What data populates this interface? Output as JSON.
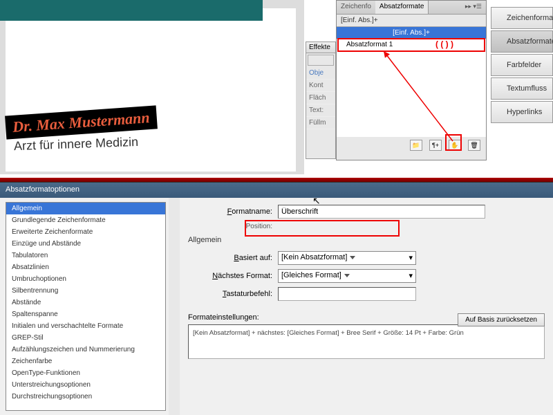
{
  "document": {
    "name": "Dr. Max Mustermann",
    "subtitle": "Arzt für innere Medizin"
  },
  "right_toolbar": {
    "items": [
      {
        "label": "Zeichenformate"
      },
      {
        "label": "Absatzformate"
      },
      {
        "label": "Farbfelder"
      },
      {
        "label": "Textumfluss"
      },
      {
        "label": "Hyperlinks"
      }
    ]
  },
  "effects": {
    "tab": "Effekte",
    "rows": [
      "Obje",
      "Kont",
      "Fläch",
      "Text:",
      "Füllm"
    ]
  },
  "styles_panel": {
    "tabs": [
      "Zeichenfo",
      "Absatzformate"
    ],
    "tab_icons": "▸▸ ▾☰",
    "subtitle": "[Einf. Abs.]+",
    "items": [
      {
        "label": "[Einf. Abs.]+",
        "selected": true
      },
      {
        "label": "Absatzformat 1",
        "selected": false
      }
    ],
    "annotation": "( (   ) )",
    "footer_icons": [
      "📁",
      "¶+",
      "✋",
      "🗑"
    ]
  },
  "dialog": {
    "title": "Absatzformatoptionen",
    "categories": [
      "Allgemein",
      "Grundlegende Zeichenformate",
      "Erweiterte Zeichenformate",
      "Einzüge und Abstände",
      "Tabulatoren",
      "Absatzlinien",
      "Umbruchoptionen",
      "Silbentrennung",
      "Abstände",
      "Spaltenspanne",
      "Initialen und verschachtelte Formate",
      "GREP-Stil",
      "Aufzählungszeichen und Nummerierung",
      "Zeichenfarbe",
      "OpenType-Funktionen",
      "Unterstreichungsoptionen",
      "Durchstreichungsoptionen"
    ],
    "selected_category": 0,
    "form": {
      "formatname_label": "Formatname:",
      "formatname_value": "Überschrift",
      "position_label": "Position:",
      "section": "Allgemein",
      "basiert_label": "Basiert auf:",
      "basiert_value": "[Kein Absatzformat]",
      "naechstes_label": "Nächstes Format:",
      "naechstes_value": "[Gleiches Format]",
      "tastatur_label": "Tastaturbefehl:",
      "tastatur_value": "",
      "settings_label": "Formateinstellungen:",
      "reset_button": "Auf Basis zurücksetzen",
      "settings_summary": "[Kein Absatzformat] + nächstes: [Gleiches Format] + Bree Serif + Größe: 14 Pt + Farbe: Grün"
    }
  }
}
